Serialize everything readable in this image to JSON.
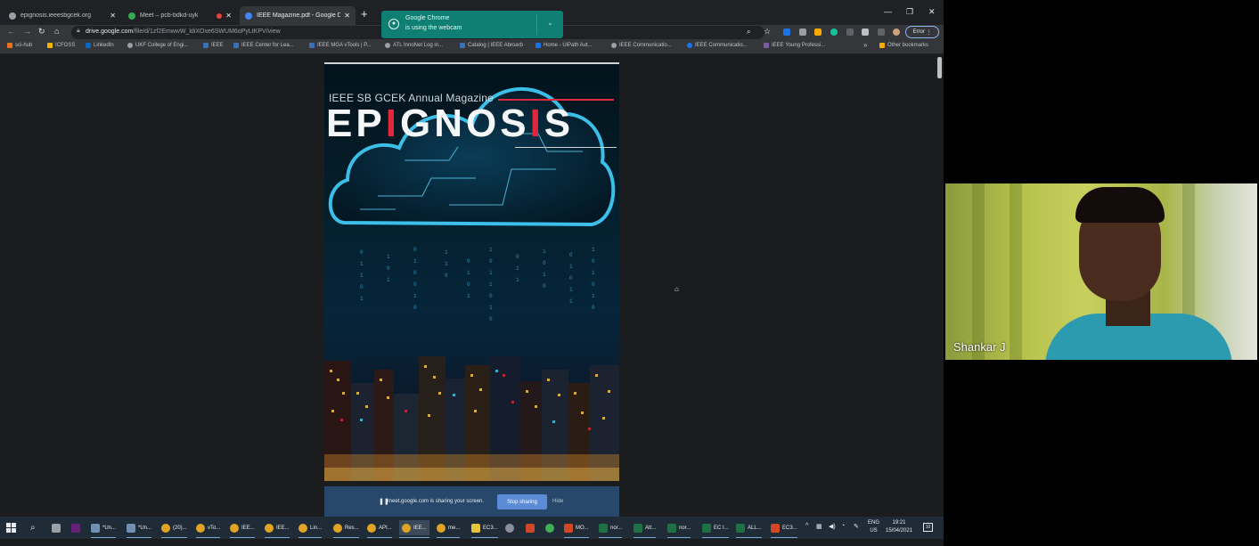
{
  "browser": {
    "tabs": [
      {
        "title": "epignosis.ieeesbgcek.org",
        "active": false,
        "recording": false
      },
      {
        "title": "Meet – pcb-bdkd-uyk",
        "active": false,
        "recording": true
      },
      {
        "title": "IEEE Magazine.pdf - Google Dri...",
        "active": true,
        "recording": false
      }
    ],
    "url_host": "drive.google.com",
    "url_path": "/file/d/1zf2EmwwW_ldiXOxe6SWUM6oPyLtKPV/view",
    "profile_status": "Error",
    "bookmarks": [
      "sci-hub",
      "ICFOSS",
      "LinkedIn",
      "UKF College of Engi...",
      "IEEE",
      "IEEE Center for Lea...",
      "IEEE MGA vTools | P...",
      "ATL InnoNet Log in...",
      "Catalog | IEEE Abroarb",
      "Home - UiPath Aut...",
      "IEEE Communicatio...",
      "IEEE Communicatio...",
      "IEEE Young Professi..."
    ],
    "bookmarks_more": "»",
    "other_bookmarks": "Other bookmarks"
  },
  "webcam_notice": {
    "title": "Google Chrome",
    "subtitle": "is using the webcam"
  },
  "magazine": {
    "subtitle": "IEEE SB GCEK Annual Magazine",
    "title": "EPIGNOSIS",
    "accent_color": "#e2263b"
  },
  "share_bar": {
    "message": "meet.google.com is sharing your screen.",
    "stop_label": "Stop sharing",
    "hide_label": "Hide"
  },
  "taskbar": {
    "items": [
      {
        "label": "*Un...",
        "color": "#6f8fb3"
      },
      {
        "label": "*Un...",
        "color": "#6f8fb3"
      },
      {
        "label": "(20)...",
        "color": "#e0a424"
      },
      {
        "label": "vTo...",
        "color": "#e0a424"
      },
      {
        "label": "IEE...",
        "color": "#e0a424"
      },
      {
        "label": "IEE...",
        "color": "#e0a424"
      },
      {
        "label": "Lin...",
        "color": "#e0a424"
      },
      {
        "label": "Res...",
        "color": "#e0a424"
      },
      {
        "label": "API...",
        "color": "#e0a424"
      },
      {
        "label": "IEE...",
        "color": "#e0a424"
      },
      {
        "label": "me...",
        "color": "#e0a424"
      },
      {
        "label": "EC3...",
        "color": "#e8c340"
      },
      {
        "label": "MO...",
        "color": "#d24726"
      },
      {
        "label": "nor...",
        "color": "#1e7145"
      },
      {
        "label": "Att...",
        "color": "#1e7145"
      },
      {
        "label": "nor...",
        "color": "#1e7145"
      },
      {
        "label": "EC I...",
        "color": "#1e7145"
      },
      {
        "label": "ALL...",
        "color": "#1e7145"
      },
      {
        "label": "EC3...",
        "color": "#d24726"
      }
    ],
    "lang_line1": "ENG",
    "lang_line2": "US",
    "time": "19:21",
    "date": "15/04/2021",
    "notifications": "10"
  },
  "participant": {
    "name": "Shankar J"
  }
}
